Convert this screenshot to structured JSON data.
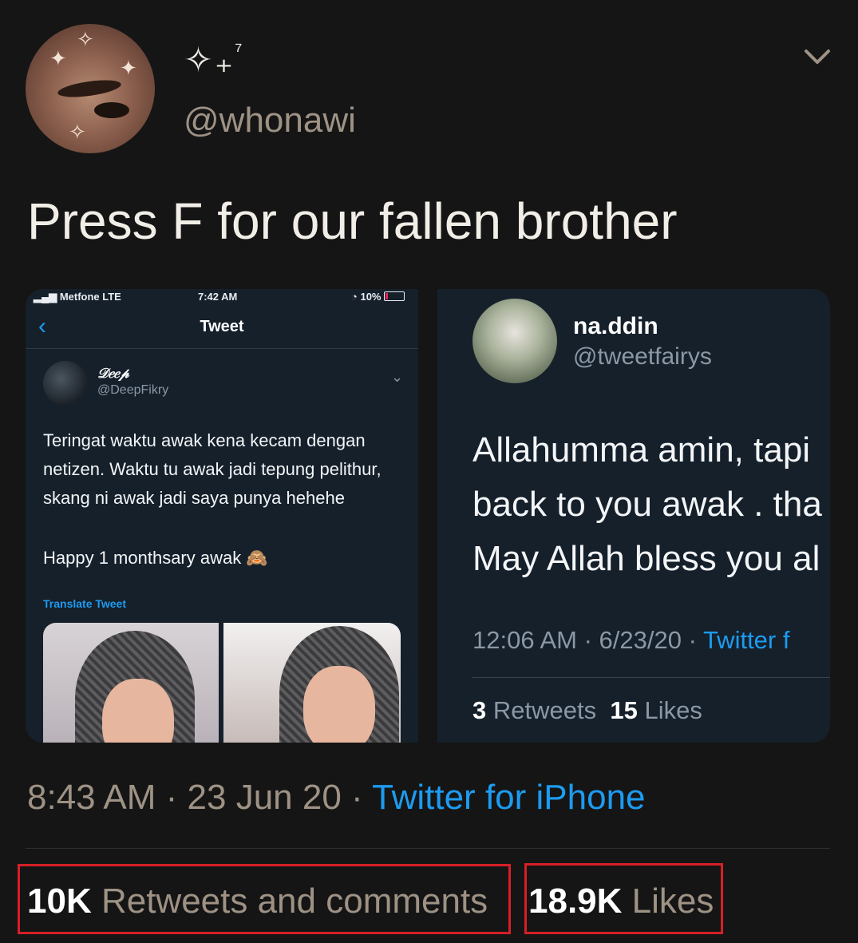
{
  "author": {
    "display_name": "✧₊",
    "display_name_sup": "⁷",
    "handle": "@whonawi"
  },
  "tweet": {
    "text": "Press F for our fallen brother",
    "time": "8:43 AM",
    "date": "23 Jun 20",
    "source": "Twitter for iPhone",
    "stats": {
      "retweets_count": "10K",
      "retweets_label": "Retweets and comments",
      "likes_count": "18.9K",
      "likes_label": "Likes"
    }
  },
  "embedded_left": {
    "status_bar": {
      "carrier": "Metfone LTE",
      "time": "7:42 AM",
      "battery": "10%"
    },
    "title": "Tweet",
    "author_name": "𝒟𝑒𝑒𝓅",
    "author_handle": "@DeepFikry",
    "body": "Teringat waktu awak kena kecam dengan netizen. Waktu tu awak jadi tepung pelithur, skang ni awak jadi saya punya hehehe",
    "body2": "Happy 1 monthsary awak 🙈",
    "translate": "Translate Tweet"
  },
  "embedded_right": {
    "author_name": "na.ddin",
    "author_handle": "@tweetfairys",
    "lines": [
      "Allahumma amin, tapi",
      "back to you awak . tha",
      "May Allah bless you al"
    ],
    "time": "12:06 AM · 6/23/20 · ",
    "source": "Twitter f",
    "retweets_count": "3",
    "retweets_label": "Retweets",
    "likes_count": "15",
    "likes_label": "Likes"
  },
  "colors": {
    "link": "#1d9bf0",
    "highlight_box": "#d61f26",
    "background": "#151515"
  },
  "icons": [
    "chevron-down-icon",
    "back-arrow-icon",
    "monkey-emoji-icon"
  ]
}
